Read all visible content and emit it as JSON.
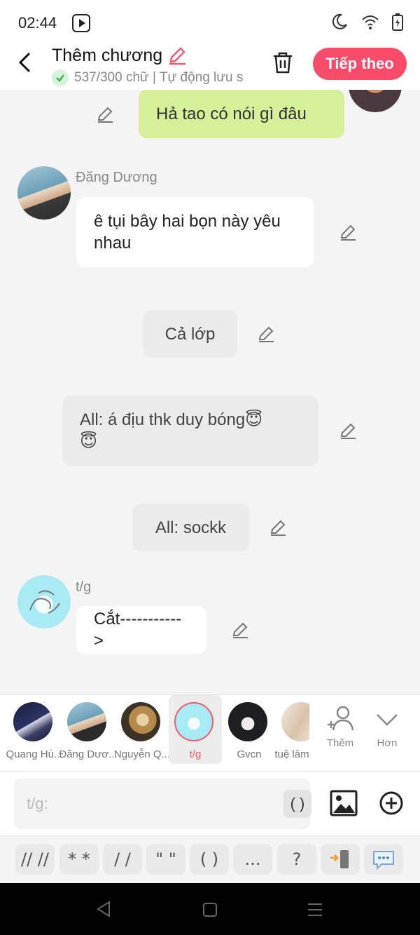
{
  "status_bar": {
    "time": "02:44"
  },
  "header": {
    "title": "Thêm chương",
    "subtitle": "537/300 chữ | Tự động lưu s",
    "next_button": "Tiếp theo"
  },
  "messages": [
    {
      "type": "outgoing",
      "text": "Hả tao có nói gì đâu"
    },
    {
      "type": "incoming",
      "sender": "Đăng Dương",
      "text_line1": "ê tụi bây hai bọn này yêu",
      "text_line2": "nhau"
    },
    {
      "type": "narration",
      "text": "Cả lớp"
    },
    {
      "type": "narration",
      "text_line1": "All: á địu thk duy bóng😇",
      "text_line2": "😇"
    },
    {
      "type": "narration",
      "text": "All: sockk"
    },
    {
      "type": "incoming",
      "sender": "t/g",
      "text": "Cắt----------->"
    }
  ],
  "characters": [
    {
      "name": "Quang Hù...",
      "selected": false
    },
    {
      "name": "Đăng Dươ...",
      "selected": false
    },
    {
      "name": "Nguyễn Q...",
      "selected": false
    },
    {
      "name": "t/g",
      "selected": true
    },
    {
      "name": "Gvcn",
      "selected": false
    },
    {
      "name": "tuệ lâm",
      "selected": false
    }
  ],
  "picker_tools": {
    "add_label": "Thêm",
    "more_label": "Hơn"
  },
  "input": {
    "placeholder": "t/g:",
    "paren_button": "( )"
  },
  "symbols": [
    "// //",
    "* *",
    "/ /",
    "\" \"",
    "( )",
    "..."
  ],
  "symbols_extra": {
    "question": "?"
  },
  "colors": {
    "accent": "#f94b6a",
    "outgoing_bubble": "#d6f09a",
    "background": "#f4f4f4"
  }
}
